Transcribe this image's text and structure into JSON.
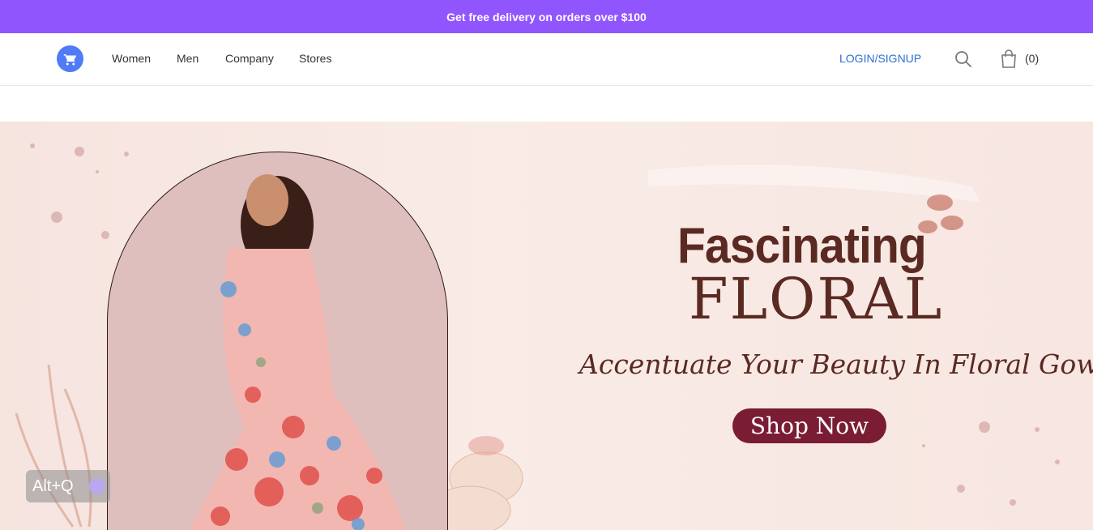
{
  "promo": {
    "text": "Get free delivery on orders over $100"
  },
  "header": {
    "nav": [
      "Women",
      "Men",
      "Company",
      "Stores"
    ],
    "login_label": "LOGIN/SIGNUP",
    "cart_count": "(0)"
  },
  "hero": {
    "headline_line1": "Fascinating",
    "headline_line2": "FLORAL",
    "tagline": "Accentuate Your Beauty In Floral Gowns.",
    "cta_label": "Shop Now"
  },
  "overlay": {
    "shortcut_label": "Alt+Q"
  },
  "colors": {
    "promo_bg": "#9155fd",
    "accent": "#2e6fd1",
    "cta_bg": "#7a1c33",
    "headline": "#5a2a22"
  }
}
